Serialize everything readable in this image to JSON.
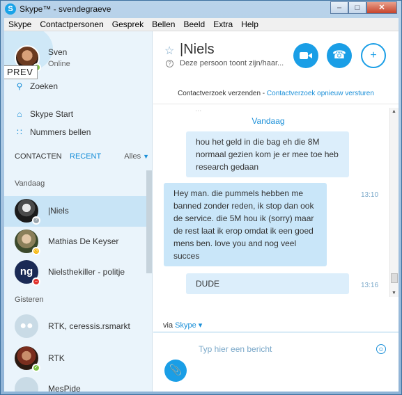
{
  "window": {
    "title": "Skype™ - svendegraeve",
    "app_icon": "skype-logo-icon",
    "controls": [
      "minimize",
      "maximize",
      "close"
    ]
  },
  "menu": [
    "Skype",
    "Contactpersonen",
    "Gesprek",
    "Bellen",
    "Beeld",
    "Extra",
    "Help"
  ],
  "profile": {
    "name": "Sven",
    "status": "Online",
    "status_color": "#7cc243"
  },
  "overlay_label": "PREV",
  "sidebar": {
    "search": "Zoeken",
    "skype_home": "Skype Start",
    "dial": "Nummers bellen"
  },
  "tabs": {
    "contacts": "CONTACTEN",
    "recent": "RECENT",
    "filter": "Alles"
  },
  "groups": {
    "today": "Vandaag",
    "yesterday": "Gisteren"
  },
  "contacts": [
    {
      "name": "|Niels",
      "selected": true,
      "status": "pending",
      "badge": "?"
    },
    {
      "name": "Mathias De Keyser",
      "status": "away",
      "badge": "◷"
    },
    {
      "name": "Nielsthekiller - politje",
      "status": "busy",
      "badge": "–"
    },
    {
      "name": "RTK, ceressis.rsmarkt",
      "status": "group"
    },
    {
      "name": "RTK",
      "status": "online",
      "badge": "✓"
    },
    {
      "name": "MesPide"
    }
  ],
  "chat": {
    "title": "|Niels",
    "subtitle": "Deze persoon toont zijn/haar...",
    "request_text": "Contactverzoek verzenden - ",
    "request_link": "Contactverzoek opnieuw versturen",
    "faded_text": "...",
    "date_separator": "Vandaag",
    "messages": [
      {
        "dir": "out",
        "text": "hou het geld in die bag eh die 8M normaal gezien kom je er mee toe heb research gedaan",
        "time": ""
      },
      {
        "dir": "in",
        "text": "Hey man. die pummels hebben me banned zonder reden, ik stop dan ook de service. die 5M hou ik (sorry) maar de rest laat ik erop omdat ik een goed mens ben. love you and nog veel succes",
        "time": "13:10"
      },
      {
        "dir": "out",
        "text": "DUDE",
        "time": "13:16"
      }
    ],
    "via_label": "via ",
    "via_link": "Skype",
    "compose_placeholder": "Typ hier een bericht"
  },
  "colors": {
    "accent": "#1a9ee6",
    "selected_row": "#c8e4f6",
    "bubble": "#c9e6f9"
  }
}
